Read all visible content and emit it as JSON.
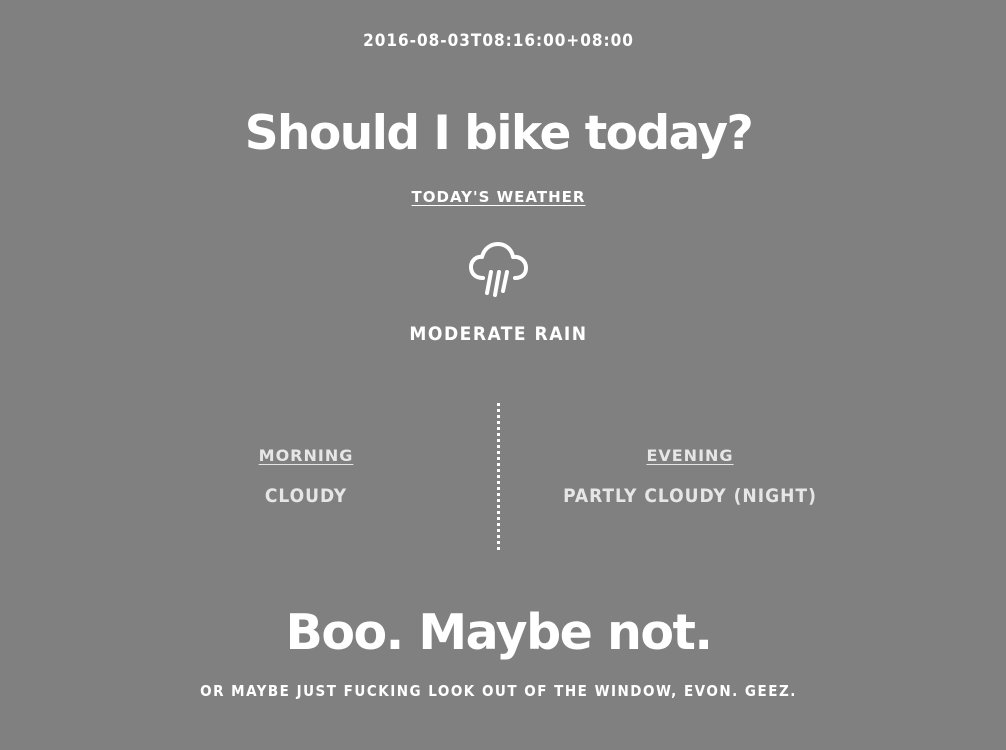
{
  "timestamp": "2016-08-03T08:16:00+08:00",
  "title": "Should I bike today?",
  "todays_weather": {
    "heading": "TODAY'S WEATHER",
    "icon": "cloud-rain-icon",
    "condition": "MODERATE RAIN"
  },
  "forecast": {
    "morning": {
      "label": "MORNING",
      "condition": "CLOUDY"
    },
    "evening": {
      "label": "EVENING",
      "condition": "PARTLY CLOUDY (NIGHT)"
    }
  },
  "verdict": "Boo. Maybe not.",
  "footer_note": "OR MAYBE JUST FUCKING LOOK OUT OF THE WINDOW, EVON. GEEZ.",
  "colors": {
    "background": "#808080",
    "text": "#ffffff",
    "muted_text": "#e6e6e6"
  }
}
